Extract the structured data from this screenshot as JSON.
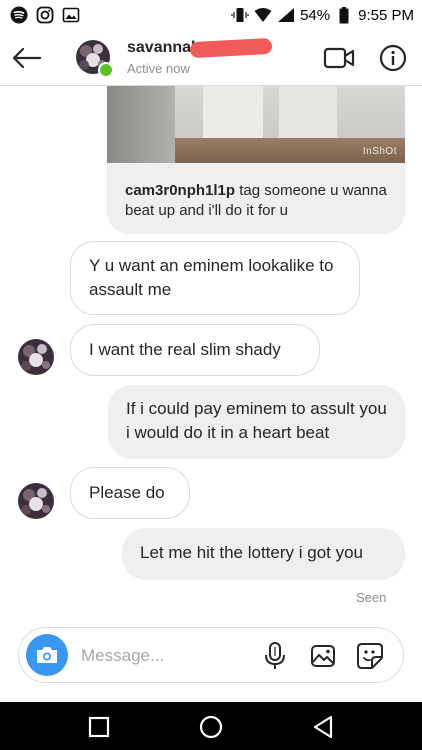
{
  "status_bar": {
    "battery": "54%",
    "time": "9:55 PM",
    "left_icons": [
      "spotify-icon",
      "instagram-icon",
      "gallery-icon"
    ],
    "right_icons": [
      "vibrate-icon",
      "wifi-icon",
      "signal-icon",
      "battery-icon"
    ]
  },
  "header": {
    "contact_name": "savannah",
    "status": "Active now",
    "online_color": "#58c322"
  },
  "shared_post": {
    "watermark": "InShOt",
    "username": "cam3r0nph1l1p",
    "caption": "tag someone u wanna beat up and i'll do it for u"
  },
  "messages": [
    {
      "direction": "incoming",
      "text": "Y u want an eminem lookalike to assault me",
      "avatar": false
    },
    {
      "direction": "incoming",
      "text": "I want the real slim shady",
      "avatar": true
    },
    {
      "direction": "outgoing",
      "text": "If i could pay eminem to assult you i would do it in a heart beat"
    },
    {
      "direction": "incoming",
      "text": "Please do",
      "avatar": true
    },
    {
      "direction": "outgoing",
      "text": "Let me hit the lottery i got you"
    }
  ],
  "seen_label": "Seen",
  "composer": {
    "placeholder": "Message...",
    "accent_color": "#3897f0"
  }
}
